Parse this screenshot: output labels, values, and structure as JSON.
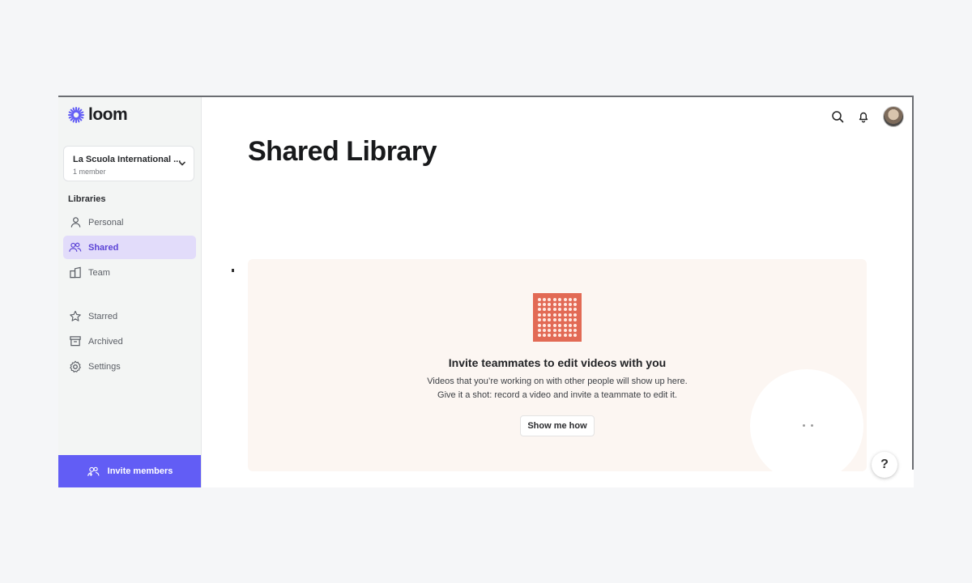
{
  "brand": {
    "name": "loom",
    "accent": "#625df5",
    "logo_color": "#625df5"
  },
  "workspace": {
    "name": "La Scuola International ...",
    "members": "1 member"
  },
  "sidebar": {
    "section_label": "Libraries",
    "items": [
      {
        "label": "Personal",
        "icon": "person-icon",
        "active": false
      },
      {
        "label": "Shared",
        "icon": "people-icon",
        "active": true
      },
      {
        "label": "Team",
        "icon": "building-icon",
        "active": false
      },
      {
        "label": "Starred",
        "icon": "star-icon",
        "active": false
      },
      {
        "label": "Archived",
        "icon": "archive-icon",
        "active": false
      },
      {
        "label": "Settings",
        "icon": "gear-icon",
        "active": false
      }
    ],
    "invite_label": "Invite members"
  },
  "header": {
    "title": "Shared Library"
  },
  "empty_state": {
    "title": "Invite teammates to edit videos with you",
    "line1": "Videos that you’re working on with other people will show up here.",
    "line2": "Give it a shot: record a video and invite a teammate to edit it.",
    "button_label": "Show me how"
  },
  "help": {
    "label": "?"
  }
}
